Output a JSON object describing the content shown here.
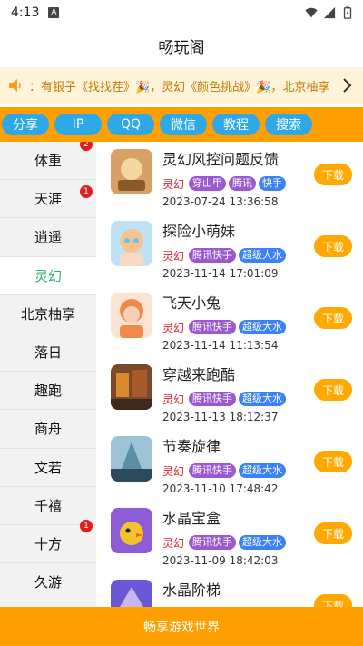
{
  "status": {
    "time": "4:13",
    "badge": "A"
  },
  "title": "畅玩阁",
  "marquee": {
    "text": "：有银子《找找茬》🎉，灵幻《颜色挑战》🎉，北京柚享"
  },
  "chips": [
    "分享",
    "IP",
    "QQ",
    "微信",
    "教程",
    "搜索"
  ],
  "sidebar": {
    "items": [
      {
        "label": "体重",
        "badge": "2"
      },
      {
        "label": "天涯",
        "badge": "1"
      },
      {
        "label": "逍遥",
        "badge": ""
      },
      {
        "label": "灵幻",
        "badge": ""
      },
      {
        "label": "北京柚享",
        "badge": ""
      },
      {
        "label": "落日",
        "badge": ""
      },
      {
        "label": "趣跑",
        "badge": ""
      },
      {
        "label": "商舟",
        "badge": ""
      },
      {
        "label": "文若",
        "badge": ""
      },
      {
        "label": "千禧",
        "badge": ""
      },
      {
        "label": "十方",
        "badge": "1"
      },
      {
        "label": "久游",
        "badge": ""
      }
    ],
    "active_index": 3
  },
  "games": [
    {
      "name": "灵幻风控问题反馈",
      "category": "灵幻",
      "tags": [
        "穿山甲",
        "腾讯",
        "快手"
      ],
      "date": "2023-07-24 13:36:58",
      "button": "下载",
      "icon_colors": [
        "#D9A066",
        "#8B5A2B"
      ]
    },
    {
      "name": "探险小萌妹",
      "category": "灵幻",
      "tags": [
        "腾讯快手",
        "超级大水"
      ],
      "date": "2023-11-14 17:01:09",
      "button": "下载",
      "icon_colors": [
        "#F6C48E",
        "#6EC1E4"
      ]
    },
    {
      "name": "飞天小兔",
      "category": "灵幻",
      "tags": [
        "腾讯快手",
        "超级大水"
      ],
      "date": "2023-11-14 11:13:54",
      "button": "下载",
      "icon_colors": [
        "#F08A4B",
        "#F7D1B5"
      ]
    },
    {
      "name": "穿越来跑酷",
      "category": "灵幻",
      "tags": [
        "腾讯快手",
        "超级大水"
      ],
      "date": "2023-11-13 18:12:37",
      "button": "下载",
      "icon_colors": [
        "#7A4A2A",
        "#D9892E"
      ]
    },
    {
      "name": "节奏旋律",
      "category": "灵幻",
      "tags": [
        "腾讯快手",
        "超级大水"
      ],
      "date": "2023-11-10 17:48:42",
      "button": "下载",
      "icon_colors": [
        "#5B8FA8",
        "#2E4A5E"
      ]
    },
    {
      "name": "水晶宝盒",
      "category": "灵幻",
      "tags": [
        "腾讯快手",
        "超级大水"
      ],
      "date": "2023-11-09 18:42:03",
      "button": "下载",
      "icon_colors": [
        "#8E5BD6",
        "#F2C22E"
      ]
    },
    {
      "name": "水晶阶梯",
      "category": "",
      "tags": [],
      "date": "",
      "button": "下载",
      "icon_colors": [
        "#6A58D6",
        "#C9B6F2"
      ]
    }
  ],
  "footer": "畅享游戏世界",
  "colors": {
    "orange": "#FF9F00",
    "chip_blue": "#2EA8E6",
    "active_green": "#2DB26A",
    "tag_purple": "#9B59D0",
    "tag_blue": "#3B82F6"
  }
}
